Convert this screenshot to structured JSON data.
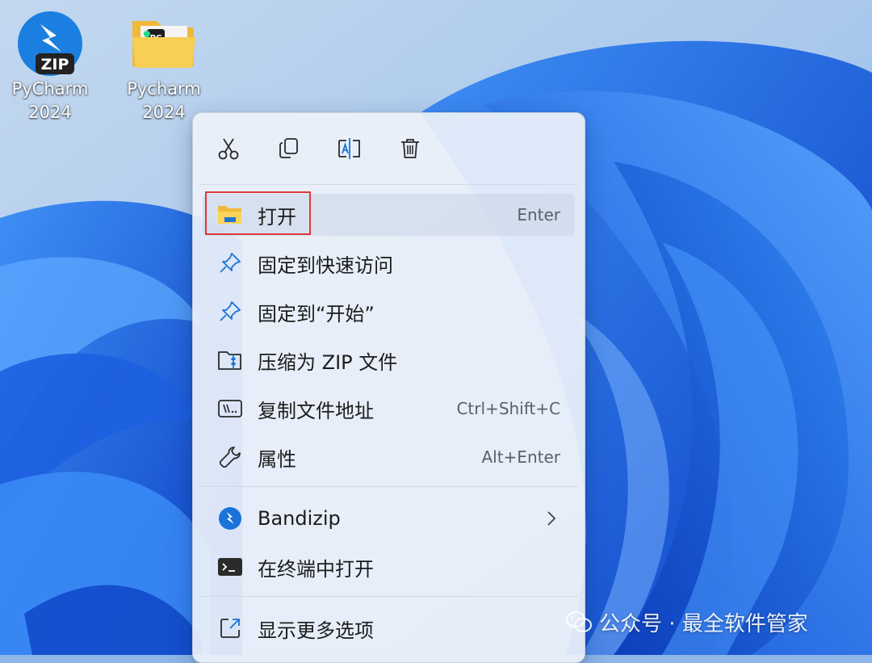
{
  "desktop": {
    "icons": [
      {
        "label_line1": "PyCharm",
        "label_line2": "2024",
        "icon": "bandizip-zip-archive-icon",
        "badge": "ZIP"
      },
      {
        "label_line1": "Pycharm",
        "label_line2": "2024",
        "icon": "folder-icon",
        "badge": "PC"
      }
    ]
  },
  "context_menu": {
    "toolbar": [
      {
        "icon": "cut-icon"
      },
      {
        "icon": "copy-icon"
      },
      {
        "icon": "rename-icon"
      },
      {
        "icon": "delete-icon"
      }
    ],
    "items": [
      {
        "label": "打开",
        "shortcut": "Enter",
        "icon": "folder-open-icon"
      },
      {
        "label": "固定到快速访问",
        "shortcut": "",
        "icon": "pin-icon"
      },
      {
        "label": "固定到“开始”",
        "shortcut": "",
        "icon": "pin-icon"
      },
      {
        "label": "压缩为 ZIP 文件",
        "shortcut": "",
        "icon": "zip-icon"
      },
      {
        "label": "复制文件地址",
        "shortcut": "Ctrl+Shift+C",
        "icon": "copy-path-icon"
      },
      {
        "label": "属性",
        "shortcut": "Alt+Enter",
        "icon": "wrench-icon"
      },
      {
        "label": "Bandizip",
        "shortcut": "",
        "icon": "bandizip-icon",
        "has_submenu": true
      },
      {
        "label": "在终端中打开",
        "shortcut": "",
        "icon": "terminal-icon"
      },
      {
        "label": "显示更多选项",
        "shortcut": "",
        "icon": "show-more-icon"
      }
    ]
  },
  "watermark": {
    "text": "公众号 · 最全软件管家",
    "icon": "wechat-icon"
  },
  "colors": {
    "accent": "#0067c0",
    "highlight_border": "#e0363a",
    "wallpaper": "#1a5fe0"
  }
}
